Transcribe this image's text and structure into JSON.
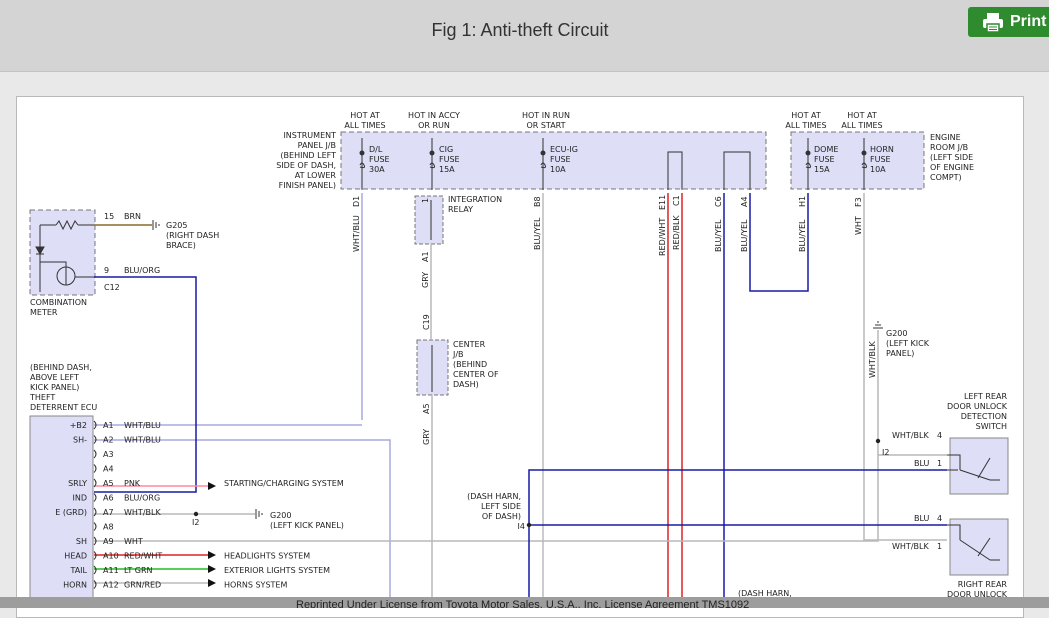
{
  "header": {
    "title": "Fig 1: Anti-theft Circuit",
    "print_label": "Print",
    "print_icon": "printer-icon"
  },
  "footer": {
    "notice": "Reprinted Under License from Toyota Motor Sales, U.S.A., Inc. License Agreement TMS1092"
  },
  "colors": {
    "jb_fill": "#dedef7",
    "wire_blue": "#1a1aa8",
    "wire_red": "#e02020",
    "wire_pink": "#ff8aa0",
    "wire_green": "#22bb22",
    "wire_gray": "#b8b8b8",
    "wire_lightblue": "#a8a8dd",
    "wire_brown": "#8a6a2a"
  },
  "diagram": {
    "instrument_panel_jb": [
      "INSTRUMENT",
      "PANEL J/B",
      "(BEHIND LEFT",
      "SIDE OF DASH,",
      "AT LOWER",
      "FINISH PANEL)"
    ],
    "engine_room_jb": [
      "ENGINE",
      "ROOM J/B",
      "(LEFT SIDE",
      "OF ENGINE",
      "COMPT)"
    ],
    "hot_labels": {
      "dl": [
        "HOT AT",
        "ALL TIMES"
      ],
      "cig": [
        "HOT IN ACCY",
        "OR RUN"
      ],
      "ecuig": [
        "HOT IN RUN",
        "OR START"
      ],
      "dome": [
        "HOT AT",
        "ALL TIMES"
      ],
      "horn": [
        "HOT AT",
        "ALL TIMES"
      ]
    },
    "fuses": {
      "dl": [
        "D/L",
        "FUSE",
        "30A"
      ],
      "cig": [
        "CIG",
        "FUSE",
        "15A"
      ],
      "ecuig": [
        "ECU-IG",
        "FUSE",
        "10A"
      ],
      "dome": [
        "DOME",
        "FUSE",
        "15A"
      ],
      "horn": [
        "HORN",
        "FUSE",
        "10A"
      ]
    },
    "pins": {
      "d1": "D1",
      "ir1": "1",
      "b8": "B8",
      "e11": "E11",
      "c1": "C1",
      "c6": "C6",
      "a4": "A4",
      "h1": "H1",
      "f3": "F3",
      "a1": "A1",
      "c19": "C19",
      "a5": "A5"
    },
    "wires": {
      "whtblu": "WHT/BLU",
      "gry1": "GRY",
      "bluyel_b8": "BLU/YEL",
      "redwht": "RED/WHT",
      "redblk": "RED/BLK",
      "bluyel_c6": "BLU/YEL",
      "bluyel_a4": "BLU/YEL",
      "bluyel_h1": "BLU/YEL",
      "wht_f3": "WHT",
      "gry2": "GRY",
      "whtblk_g200": "WHT/BLK"
    },
    "integration_relay": [
      "INTEGRATION",
      "RELAY"
    ],
    "center_jb": [
      "CENTER",
      "J/B",
      "(BEHIND",
      "CENTER OF",
      "DASH)"
    ],
    "combination_meter": {
      "label": [
        "COMBINATION",
        "METER"
      ],
      "pin15": "15",
      "wire15": "BRN",
      "ground": [
        "G205",
        "(RIGHT DASH",
        "BRACE)"
      ],
      "pin9": "9",
      "wire9": "BLU/ORG",
      "connector": "C12"
    },
    "g200_right": [
      "G200",
      "(LEFT KICK",
      "PANEL)"
    ],
    "ecu": {
      "label": [
        "(BEHIND DASH,",
        "ABOVE LEFT",
        "KICK PANEL)",
        "THEFT",
        "DETERRENT ECU"
      ],
      "rows": [
        {
          "term": "+B2",
          "pin": "A1",
          "wire": "WHT/BLU",
          "dest": ""
        },
        {
          "term": "SH-",
          "pin": "A2",
          "wire": "WHT/BLU",
          "dest": ""
        },
        {
          "term": "",
          "pin": "A3",
          "wire": "",
          "dest": ""
        },
        {
          "term": "",
          "pin": "A4",
          "wire": "",
          "dest": ""
        },
        {
          "term": "SRLY",
          "pin": "A5",
          "wire": "PNK",
          "dest": "STARTING/CHARGING SYSTEM"
        },
        {
          "term": "IND",
          "pin": "A6",
          "wire": "BLU/ORG",
          "dest": ""
        },
        {
          "term": "E (GRD)",
          "pin": "A7",
          "wire": "WHT/BLK",
          "dest": ""
        },
        {
          "term": "",
          "pin": "A8",
          "wire": "",
          "dest": ""
        },
        {
          "term": "SH",
          "pin": "A9",
          "wire": "WHT",
          "dest": ""
        },
        {
          "term": "HEAD",
          "pin": "A10",
          "wire": "RED/WHT",
          "dest": "HEADLIGHTS SYSTEM"
        },
        {
          "term": "TAIL",
          "pin": "A11",
          "wire": "LT GRN",
          "dest": "EXTERIOR LIGHTS SYSTEM"
        },
        {
          "term": "HORN",
          "pin": "A12",
          "wire": "GRN/RED",
          "dest": "HORNS SYSTEM"
        }
      ],
      "splice_i2": "I2",
      "a7_ground": [
        "G200",
        "(LEFT KICK PANEL)"
      ]
    },
    "dash_harness": [
      "(DASH HARN,",
      "LEFT SIDE",
      "OF DASH)"
    ],
    "splice_i4": "I4",
    "splice_i2_right": "I2",
    "dash_harness_bottom": "(DASH HARN,",
    "left_rear_switch": {
      "label": [
        "LEFT REAR",
        "DOOR UNLOCK",
        "DETECTION",
        "SWITCH"
      ],
      "pin4": "4",
      "wire4": "WHT/BLK",
      "pin1": "1",
      "wire1": "BLU"
    },
    "right_rear_switch": {
      "label": [
        "RIGHT REAR",
        "DOOR UNLOCK"
      ],
      "pin4": "4",
      "wire4": "BLU",
      "pin1": "1",
      "wire1": "WHT/BLK"
    }
  }
}
